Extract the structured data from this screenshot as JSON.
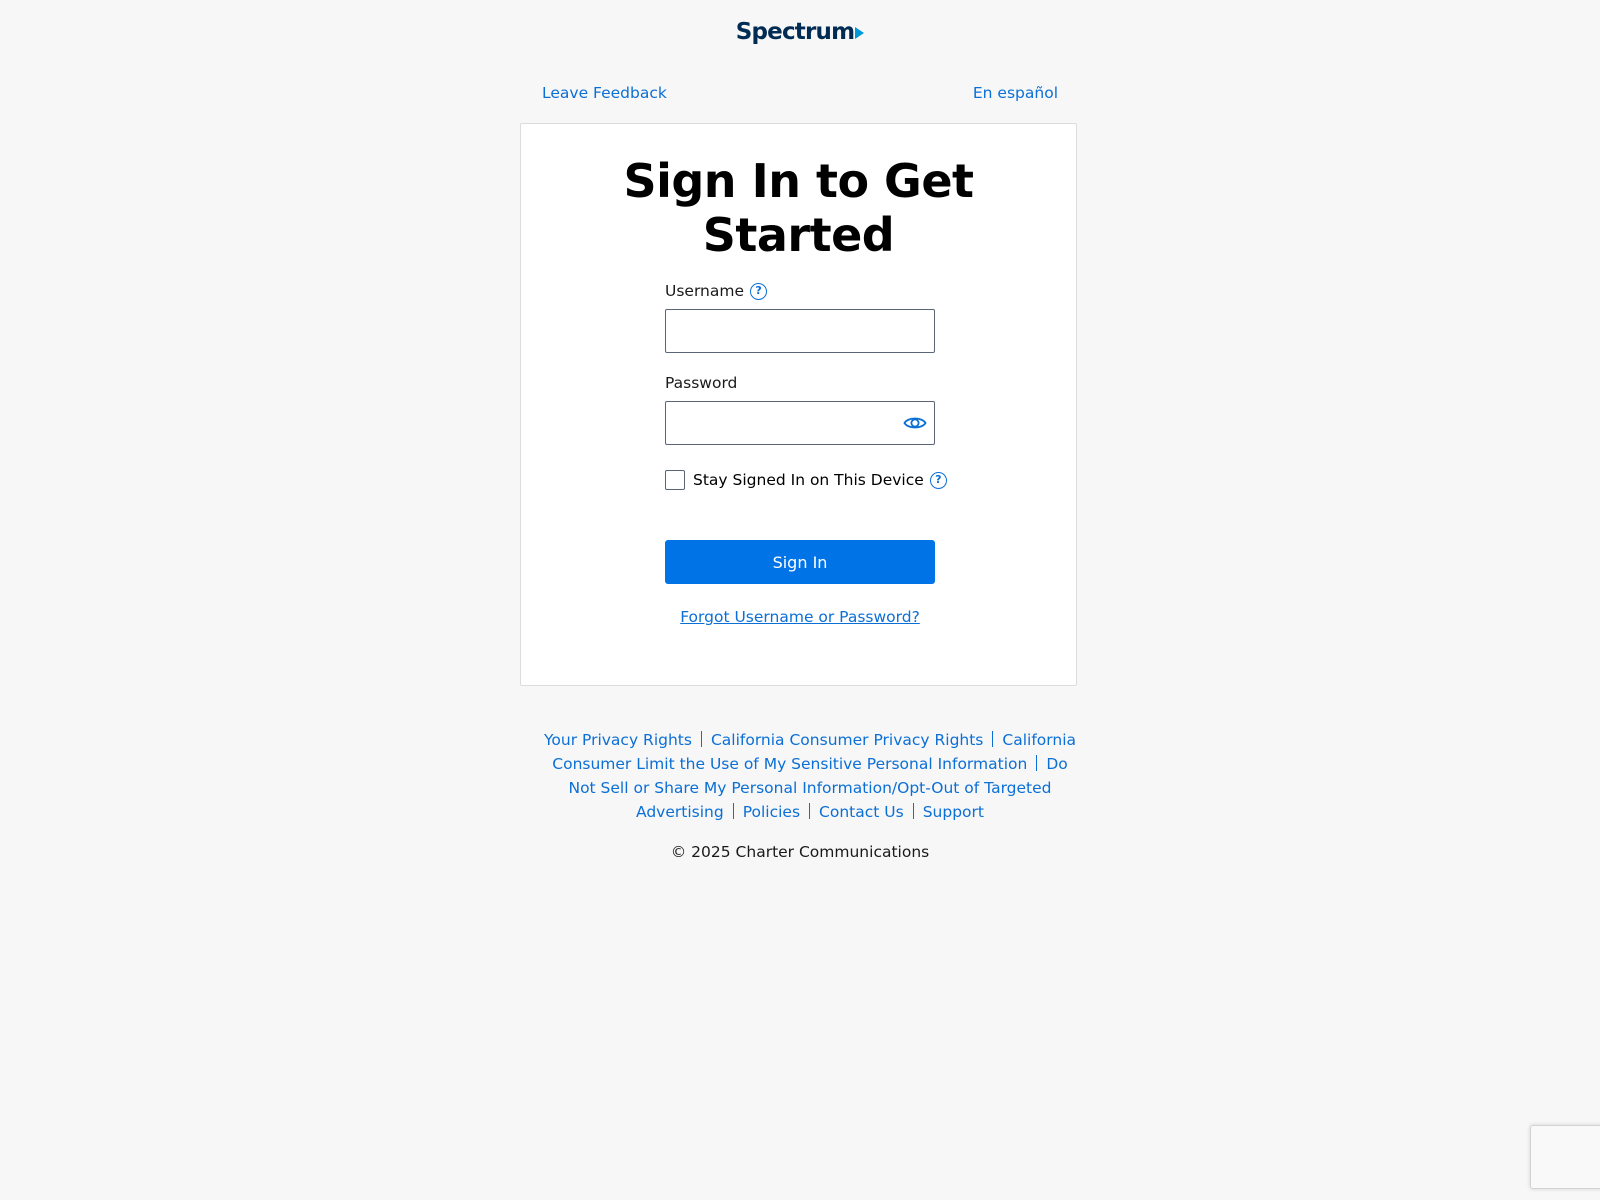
{
  "brand": {
    "logo_text": "Spectrum",
    "logo_arrow_color": "#0099d8",
    "logo_color": "#002c53"
  },
  "top_links": {
    "feedback": "Leave Feedback",
    "language": "En español"
  },
  "signin": {
    "title": "Sign In to Get Started",
    "username_label": "Username",
    "username_value": "",
    "password_label": "Password",
    "password_value": "",
    "stay_signed_in_label": "Stay Signed In on This Device",
    "help_glyph": "?",
    "submit_label": "Sign In",
    "forgot_link": "Forgot Username or Password?"
  },
  "footer": {
    "links": [
      "Your Privacy Rights",
      "California Consumer Privacy Rights",
      "California Consumer Limit the Use of My Sensitive Personal Information",
      "Do Not Sell or Share My Personal Information/Opt-Out of Targeted Advertising",
      "Policies",
      "Contact Us",
      "Support"
    ],
    "copyright": "© 2025 Charter Communications"
  },
  "colors": {
    "accent": "#0073e6",
    "link": "#0b6fd6",
    "background": "#f7f7f7"
  },
  "icons": {
    "help": "question-circle-icon",
    "password_toggle": "eye-icon"
  }
}
